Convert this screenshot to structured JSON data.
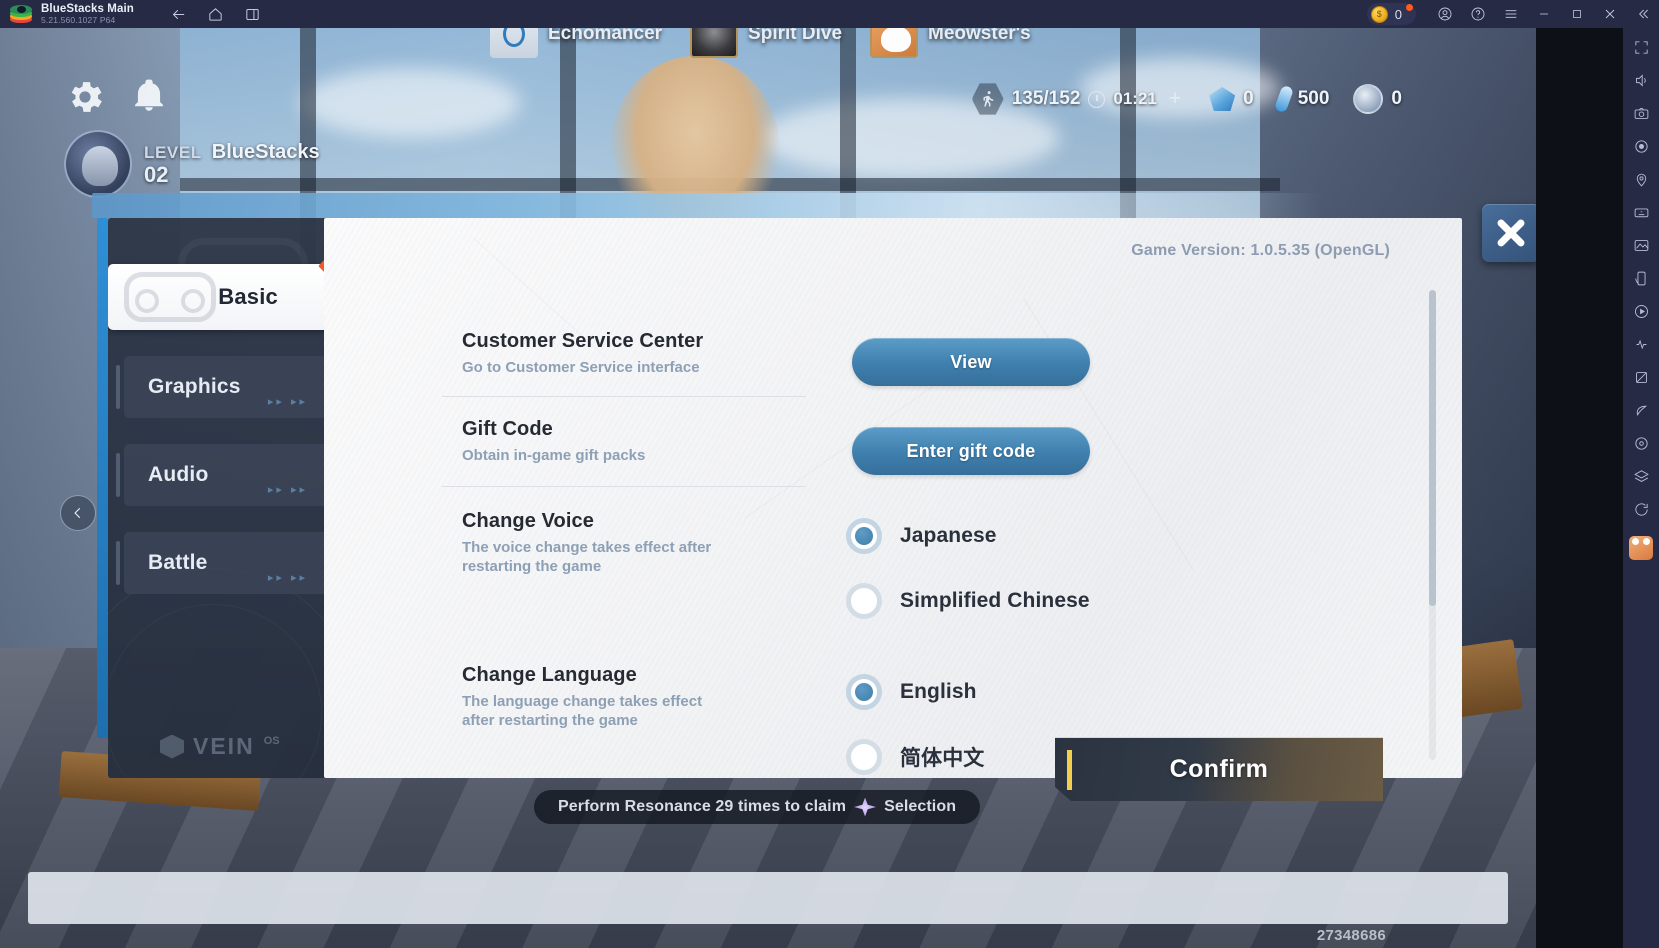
{
  "window": {
    "app_title": "BlueStacks Main",
    "app_version": "5.21.560.1027  P64",
    "nav_icons": [
      "back-icon",
      "home-icon",
      "multi-instance-icon"
    ],
    "coin_value": "0",
    "system_icons": [
      "account-icon",
      "help-icon",
      "menu-icon",
      "minimize-icon",
      "maximize-icon",
      "close-icon",
      "collapse-icon"
    ]
  },
  "rail": {
    "items": [
      "fullscreen-icon",
      "volume-icon",
      "screenshot-icon",
      "record-icon",
      "location-icon",
      "keymapping-icon",
      "gallery-icon",
      "rotate-icon",
      "macro-icon",
      "shake-icon",
      "trim-icon",
      "eco-mode-icon",
      "pin-icon",
      "layers-icon",
      "sync-icon"
    ]
  },
  "game_hud": {
    "level_label": "LEVEL",
    "player_name": "BlueStacks",
    "level_value": "02",
    "stamina": "135/152",
    "timer": "01:21",
    "gem_count": "0",
    "vial_count": "500",
    "medal_count": "0",
    "gear_icon": "settings-gear-icon",
    "bell_icon": "notification-bell-icon",
    "quest_text_before": "Perform Resonance 29 times to claim",
    "quest_text_after": "Selection",
    "server_id": "27348686",
    "bottom_nav": [
      {
        "label": "Echomancer",
        "icon": "echomancer-icon"
      },
      {
        "label": "Spirit Dive",
        "icon": "spirit-dive-icon"
      },
      {
        "label": "Meowster's",
        "icon": "meowsters-icon"
      }
    ]
  },
  "settings": {
    "version_text": "Game Version: 1.0.5.35 (OpenGL)",
    "close_label": "close-icon",
    "tabs": [
      {
        "label": "Basic",
        "active": true,
        "badge": true
      },
      {
        "label": "Graphics",
        "active": false,
        "badge": false
      },
      {
        "label": "Audio",
        "active": false,
        "badge": false
      },
      {
        "label": "Battle",
        "active": false,
        "badge": false
      }
    ],
    "arrows_glyph": "▸▸ ▸▸",
    "brand": {
      "name": "VEIN",
      "sup": "OS"
    },
    "rows": [
      {
        "title": "Customer Service Center",
        "desc": "Go to Customer Service interface",
        "button": "View"
      },
      {
        "title": "Gift Code",
        "desc": "Obtain in-game gift packs",
        "button": "Enter gift code"
      },
      {
        "title": "Change Voice",
        "desc": "The voice change takes effect after restarting the game",
        "options": [
          {
            "label": "Japanese",
            "selected": true
          },
          {
            "label": "Simplified Chinese",
            "selected": false
          }
        ]
      },
      {
        "title": "Change Language",
        "desc": "The language change takes effect after restarting the game",
        "options": [
          {
            "label": "English",
            "selected": true
          },
          {
            "label": "简体中文",
            "selected": false
          }
        ]
      }
    ],
    "confirm_label": "Confirm"
  },
  "colors": {
    "accent_blue": "#3f7fae",
    "titlebar": "#262a45",
    "badge_red": "#f05a28",
    "confirm_gold": "#f2cf4f"
  }
}
